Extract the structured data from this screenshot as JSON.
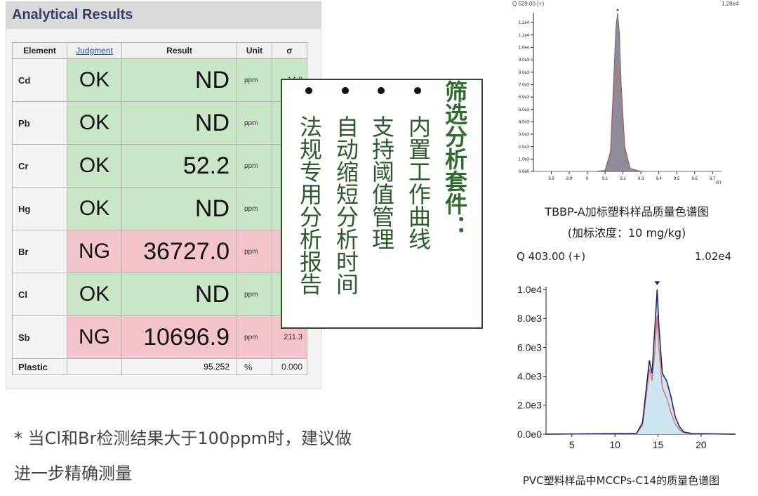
{
  "analytical_results": {
    "title": "Analytical Results",
    "columns": [
      "Element",
      "Judgment",
      "Result",
      "Unit",
      "σ"
    ],
    "rows": [
      {
        "element": "Cd",
        "judgment": "OK",
        "result": "ND",
        "unit": "ppm",
        "sigma": "14.0",
        "status": "ok"
      },
      {
        "element": "Pb",
        "judgment": "OK",
        "result": "ND",
        "unit": "ppm",
        "sigma": "",
        "status": "ok"
      },
      {
        "element": "Cr",
        "judgment": "OK",
        "result": "52.2",
        "unit": "ppm",
        "sigma": "",
        "status": "ok"
      },
      {
        "element": "Hg",
        "judgment": "OK",
        "result": "ND",
        "unit": "ppm",
        "sigma": "",
        "status": "ok"
      },
      {
        "element": "Br",
        "judgment": "NG",
        "result": "36727.0",
        "unit": "ppm",
        "sigma": "",
        "status": "ng"
      },
      {
        "element": "Cl",
        "judgment": "OK",
        "result": "ND",
        "unit": "ppm",
        "sigma": "",
        "status": "ok"
      },
      {
        "element": "Sb",
        "judgment": "NG",
        "result": "10696.9",
        "unit": "ppm",
        "sigma": "211.3",
        "status": "ng"
      }
    ],
    "footer": {
      "element": "Plastic",
      "judgment": "",
      "result": "95.252",
      "unit": "%",
      "sigma": "0.000"
    }
  },
  "colors": {
    "ok_green": "#c9e6c6",
    "ng_pink": "#f4c4cd",
    "callout_green": "#2c5a2c"
  },
  "callout": {
    "heading": "筛选分析套件：",
    "bullets": [
      "内置工作曲线",
      "支持阈值管理",
      "自动缩短分析时间",
      "法规专用分析报告"
    ]
  },
  "note": {
    "line1": "* 当Cl和Br检测结果大于100ppm时，建议做",
    "line2": "进一步精确测量"
  },
  "chart_top": {
    "header_left": "Q 529.00 (+)",
    "header_right": "1.28e4",
    "caption1": "TBBP-A加标塑料样品质量色谱图",
    "caption2": "(加标浓度：10 mg/kg)"
  },
  "chart_bottom": {
    "header_left": "Q 403.00 (+)",
    "header_right": "1.02e4",
    "caption": "PVC塑料样品中MCCPs-C14的质量色谱图"
  },
  "chart_data": [
    {
      "type": "line",
      "title": "TBBP-A加标塑料样品质量色谱图",
      "xlabel": "RT",
      "ylabel": "",
      "xlim": [
        8.7,
        9.75
      ],
      "ylim": [
        0,
        12800
      ],
      "xticks": [
        8.8,
        8.9,
        9.0,
        9.1,
        9.2,
        9.3,
        9.4,
        9.5,
        9.6,
        9.7
      ],
      "yticks": [
        0,
        1000,
        2000,
        3000,
        4000,
        5000,
        6000,
        7000,
        8000,
        9000,
        10000,
        11000,
        12000
      ],
      "ytick_labels": [
        "0.0e0",
        "1.0e3",
        "2.0e3",
        "3.0e3",
        "4.0e3",
        "5.0e3",
        "6.0e3",
        "7.0e3",
        "8.0e3",
        "9.0e3",
        "1.0e4",
        "1.1e4",
        "1.2e4"
      ],
      "series": [
        {
          "color": "#6b6b7a",
          "x": [
            8.7,
            9.05,
            9.1,
            9.13,
            9.15,
            9.16,
            9.17,
            9.18,
            9.19,
            9.21,
            9.24,
            9.3,
            9.75
          ],
          "y": [
            0,
            0,
            80,
            1600,
            8000,
            11500,
            12800,
            11200,
            7000,
            2000,
            250,
            0,
            0
          ]
        },
        {
          "color": "#e06060",
          "x": [
            8.7,
            9.05,
            9.1,
            9.13,
            9.15,
            9.16,
            9.17,
            9.18,
            9.19,
            9.21,
            9.24,
            9.3,
            9.75
          ],
          "y": [
            0,
            0,
            70,
            1400,
            6500,
            8200,
            8500,
            8000,
            5500,
            1700,
            220,
            0,
            0
          ]
        }
      ]
    },
    {
      "type": "line",
      "title": "PVC塑料样品中MCCPs-C14的质量色谱图",
      "xlabel": "",
      "ylabel": "",
      "xlim": [
        2,
        24
      ],
      "ylim": [
        0,
        10200
      ],
      "xticks": [
        5,
        10,
        15,
        20
      ],
      "yticks": [
        0,
        2000,
        4000,
        6000,
        8000,
        10000
      ],
      "ytick_labels": [
        "0.0e0",
        "2.0e3",
        "4.0e3",
        "6.0e3",
        "8.0e3",
        "1.0e4"
      ],
      "series": [
        {
          "color": "#1a2a6c",
          "x": [
            2,
            12.5,
            13.2,
            13.7,
            14.0,
            14.3,
            14.6,
            14.9,
            15.1,
            15.5,
            16.0,
            16.5,
            17.0,
            17.5,
            18.0,
            19.0,
            24
          ],
          "y": [
            0,
            50,
            800,
            3500,
            5100,
            4200,
            7000,
            10000,
            7500,
            4200,
            3700,
            2600,
            1200,
            500,
            150,
            40,
            0
          ]
        },
        {
          "color": "#e07a7a",
          "x": [
            2,
            12.5,
            13.2,
            13.7,
            14.0,
            14.3,
            14.6,
            14.9,
            15.1,
            15.5,
            16.0,
            16.5,
            17.0,
            17.5,
            18.0,
            19.0,
            24
          ],
          "y": [
            0,
            40,
            600,
            3000,
            4500,
            3700,
            5500,
            8200,
            6000,
            3200,
            2500,
            1500,
            700,
            300,
            100,
            30,
            0
          ]
        }
      ]
    }
  ]
}
